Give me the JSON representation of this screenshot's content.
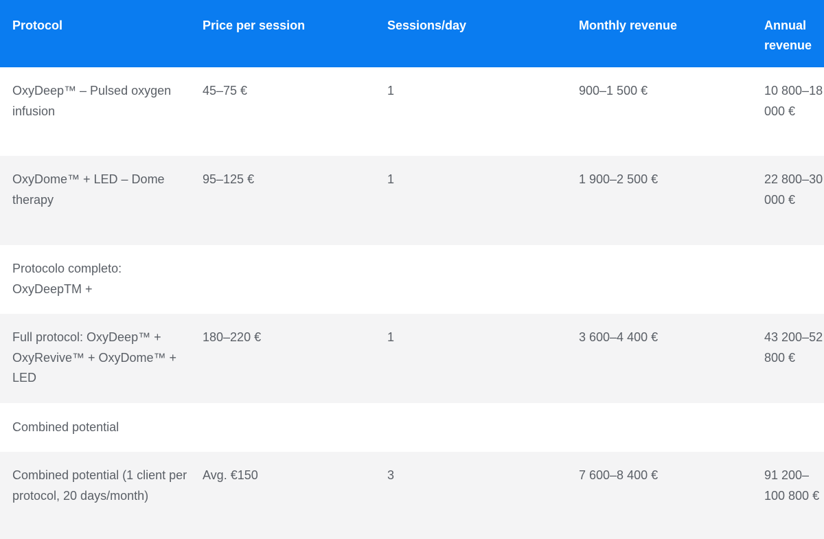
{
  "table": {
    "headers": [
      "Protocol",
      "Price per session",
      "Sessions/day",
      "Monthly revenue",
      "Annual revenue"
    ],
    "rows": [
      {
        "protocol": "OxyDeep™ – Pulsed oxygen infusion",
        "price": "45–75 €",
        "sessions": "1",
        "monthly": "900–1 500 €",
        "annual": "10 800–18 000 €"
      },
      {
        "protocol": "OxyDome™ + LED – Dome therapy",
        "price": "95–125 €",
        "sessions": "1",
        "monthly": "1 900–2 500 €",
        "annual": "22 800–30 000 €"
      },
      {
        "protocol": "Protocolo completo: OxyDeepTM +",
        "price": "",
        "sessions": "",
        "monthly": "",
        "annual": ""
      },
      {
        "protocol": "Full protocol: OxyDeep™ + OxyRevive™ + OxyDome™ + LED",
        "price": "180–220 €",
        "sessions": "1",
        "monthly": "3 600–4 400 €",
        "annual": "43 200–52 800 €"
      },
      {
        "protocol": "Combined potential",
        "price": "",
        "sessions": "",
        "monthly": "",
        "annual": ""
      },
      {
        "protocol": "Combined potential (1 client per protocol, 20 days/month)",
        "price": "Avg. €150",
        "sessions": "3",
        "monthly": "7 600–8 400 €",
        "annual": "91 200–100 800 €"
      }
    ]
  }
}
